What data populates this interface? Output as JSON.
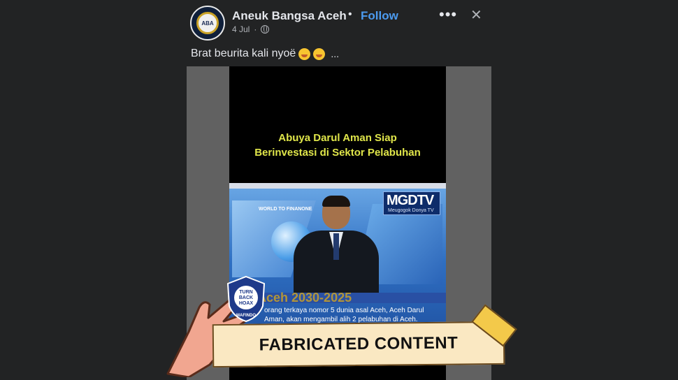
{
  "post": {
    "author": "Aneuk Bangsa Aceh",
    "separator": "•",
    "follow_label": "Follow",
    "date": "4 Jul",
    "date_sep": "·",
    "avatar_text": "ABA",
    "more_icon": "more-horizontal-icon",
    "close_icon": "close-icon",
    "more_glyph": "•••",
    "close_glyph": "✕",
    "caption": "Brat beurita kali nyoë",
    "caption_more": "...",
    "emoji_icon": "face-with-hand-over-mouth-emoji"
  },
  "video": {
    "headline_line1": "Abuya Darul Aman Siap",
    "headline_line2": "Berinvestasi di Sektor Pelabuhan",
    "channel_logo": "MGDTV",
    "channel_sub": "Meugogok Donya TV",
    "segment_label": "WORLD TO FINANONE",
    "ticker_title": "Aceh 2030-2025",
    "ticker_text": "orang terkaya nomor 5 dunia asal Aceh, Aceh Darul Aman, akan mengambil alih 2 pelabuhan di Aceh."
  },
  "sticker": {
    "label": "FABRICATED CONTENT",
    "seal_text_1": "TURN",
    "seal_text_2": "BACK",
    "seal_text_3": "HOAX",
    "seal_caption": "MAFINDO",
    "colors": {
      "banner_bg": "#fae8c2",
      "tape": "#f3c94a",
      "hand": "#f1a690"
    }
  },
  "theme": {
    "background": "#222324",
    "follow": "#4c9bf0",
    "headline": "#e0e64a"
  }
}
